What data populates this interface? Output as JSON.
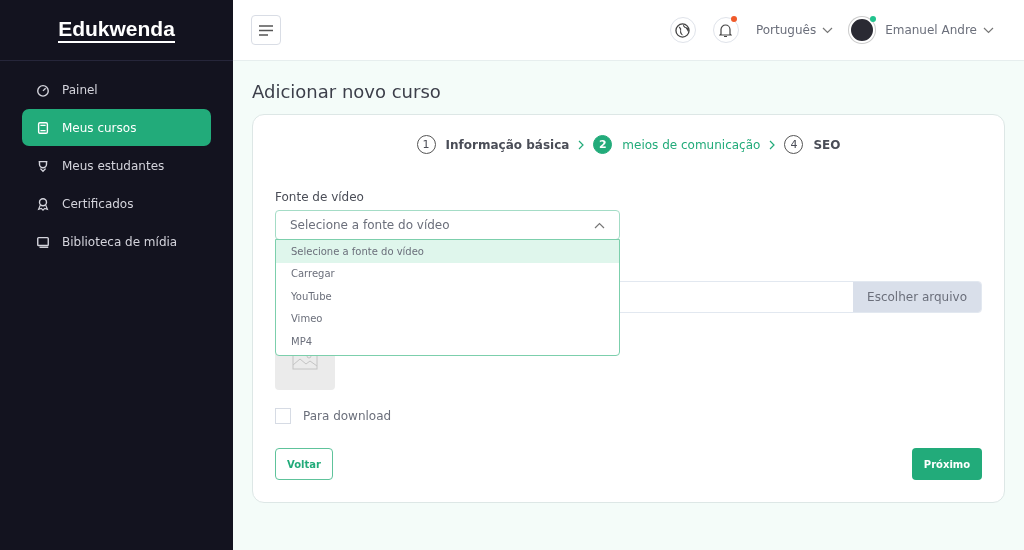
{
  "sidebar": {
    "logo": "Edukwenda",
    "items": [
      {
        "label": "Painel",
        "selected": false
      },
      {
        "label": "Meus cursos",
        "selected": true
      },
      {
        "label": "Meus estudantes",
        "selected": false
      },
      {
        "label": "Certificados",
        "selected": false
      },
      {
        "label": "Biblioteca de mídia",
        "selected": false
      }
    ]
  },
  "header": {
    "language": "Português",
    "user": "Emanuel Andre",
    "notification_unread": true,
    "user_online": true
  },
  "page_title": "Adicionar novo curso",
  "steps": [
    {
      "number": "1",
      "label": "Informação básica",
      "selected": false
    },
    {
      "number": "2",
      "label": "meios de comunicação",
      "selected": true
    },
    {
      "number": "4",
      "label": "SEO",
      "selected": false
    }
  ],
  "video_source": {
    "label": "Fonte de vídeo",
    "value": "Selecione a fonte do vídeo",
    "expanded": true,
    "options": [
      {
        "label": "Selecione a fonte do vídeo",
        "selected": true
      },
      {
        "label": "Carregar",
        "selected": false
      },
      {
        "label": "YouTube",
        "selected": false
      },
      {
        "label": "Vimeo",
        "selected": false
      },
      {
        "label": "MP4",
        "selected": false
      }
    ]
  },
  "file_button": "Escolher arquivo",
  "download": {
    "label": "Para download",
    "checked": false
  },
  "buttons": {
    "back": "Voltar",
    "next": "Próximo"
  }
}
